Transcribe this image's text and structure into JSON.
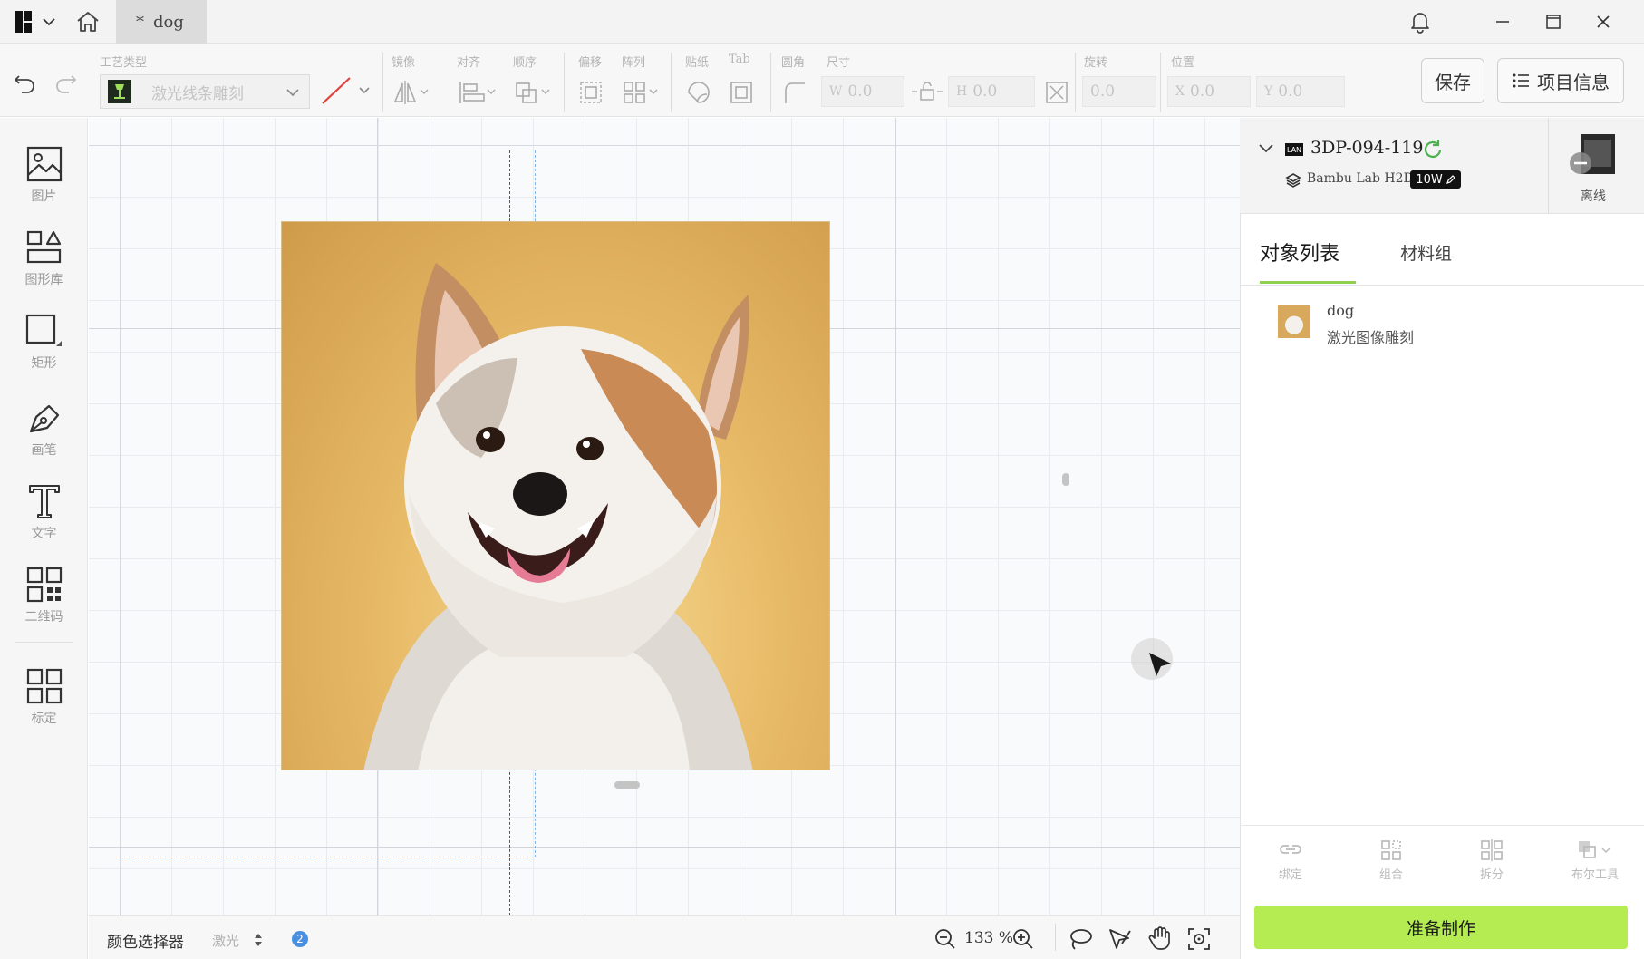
{
  "titlebar": {
    "tab_label": "dog",
    "tab_modified_mark": "*"
  },
  "toolbar": {
    "process_type_label": "工艺类型",
    "process_type_value": "激光线条雕刻",
    "mirror_label": "镜像",
    "align_label": "对齐",
    "order_label": "顺序",
    "offset_label": "偏移",
    "array_label": "阵列",
    "sticker_label": "贴纸",
    "tab_label": "Tab",
    "corner_label": "圆角",
    "size_label": "尺寸",
    "width_prefix": "W",
    "width_value": "0.0",
    "height_prefix": "H",
    "height_value": "0.0",
    "rotate_label": "旋转",
    "rotate_value": "0.0",
    "position_label": "位置",
    "x_prefix": "X",
    "x_value": "0.0",
    "y_prefix": "Y",
    "y_value": "0.0",
    "save_label": "保存",
    "project_info_label": "项目信息"
  },
  "left_tools": [
    {
      "label": "图片",
      "icon": "image-icon"
    },
    {
      "label": "图形库",
      "icon": "shape-library-icon"
    },
    {
      "label": "矩形",
      "icon": "rectangle-icon"
    },
    {
      "label": "画笔",
      "icon": "pen-icon"
    },
    {
      "label": "文字",
      "icon": "text-icon"
    },
    {
      "label": "二维码",
      "icon": "qrcode-icon"
    },
    {
      "label": "标定",
      "icon": "calibrate-icon"
    }
  ],
  "bottom_bar": {
    "color_picker_label": "颜色选择器",
    "laser_label": "激光",
    "badge_count": "2",
    "zoom_value": "133 %"
  },
  "device": {
    "name": "3DP-094-119",
    "connection": "LAN",
    "model": "Bambu Lab H2D",
    "power": "10W",
    "status": "离线"
  },
  "right_tabs": {
    "objects_label": "对象列表",
    "materials_label": "材料组"
  },
  "object_list": [
    {
      "name": "dog",
      "process": "激光图像雕刻"
    }
  ],
  "right_actions": {
    "bind_label": "绑定",
    "group_label": "组合",
    "split_label": "拆分",
    "boolean_label": "布尔工具"
  },
  "make_button_label": "准备制作",
  "colors": {
    "accent_green": "#b4ec51",
    "tab_underline": "#8fd14f"
  }
}
